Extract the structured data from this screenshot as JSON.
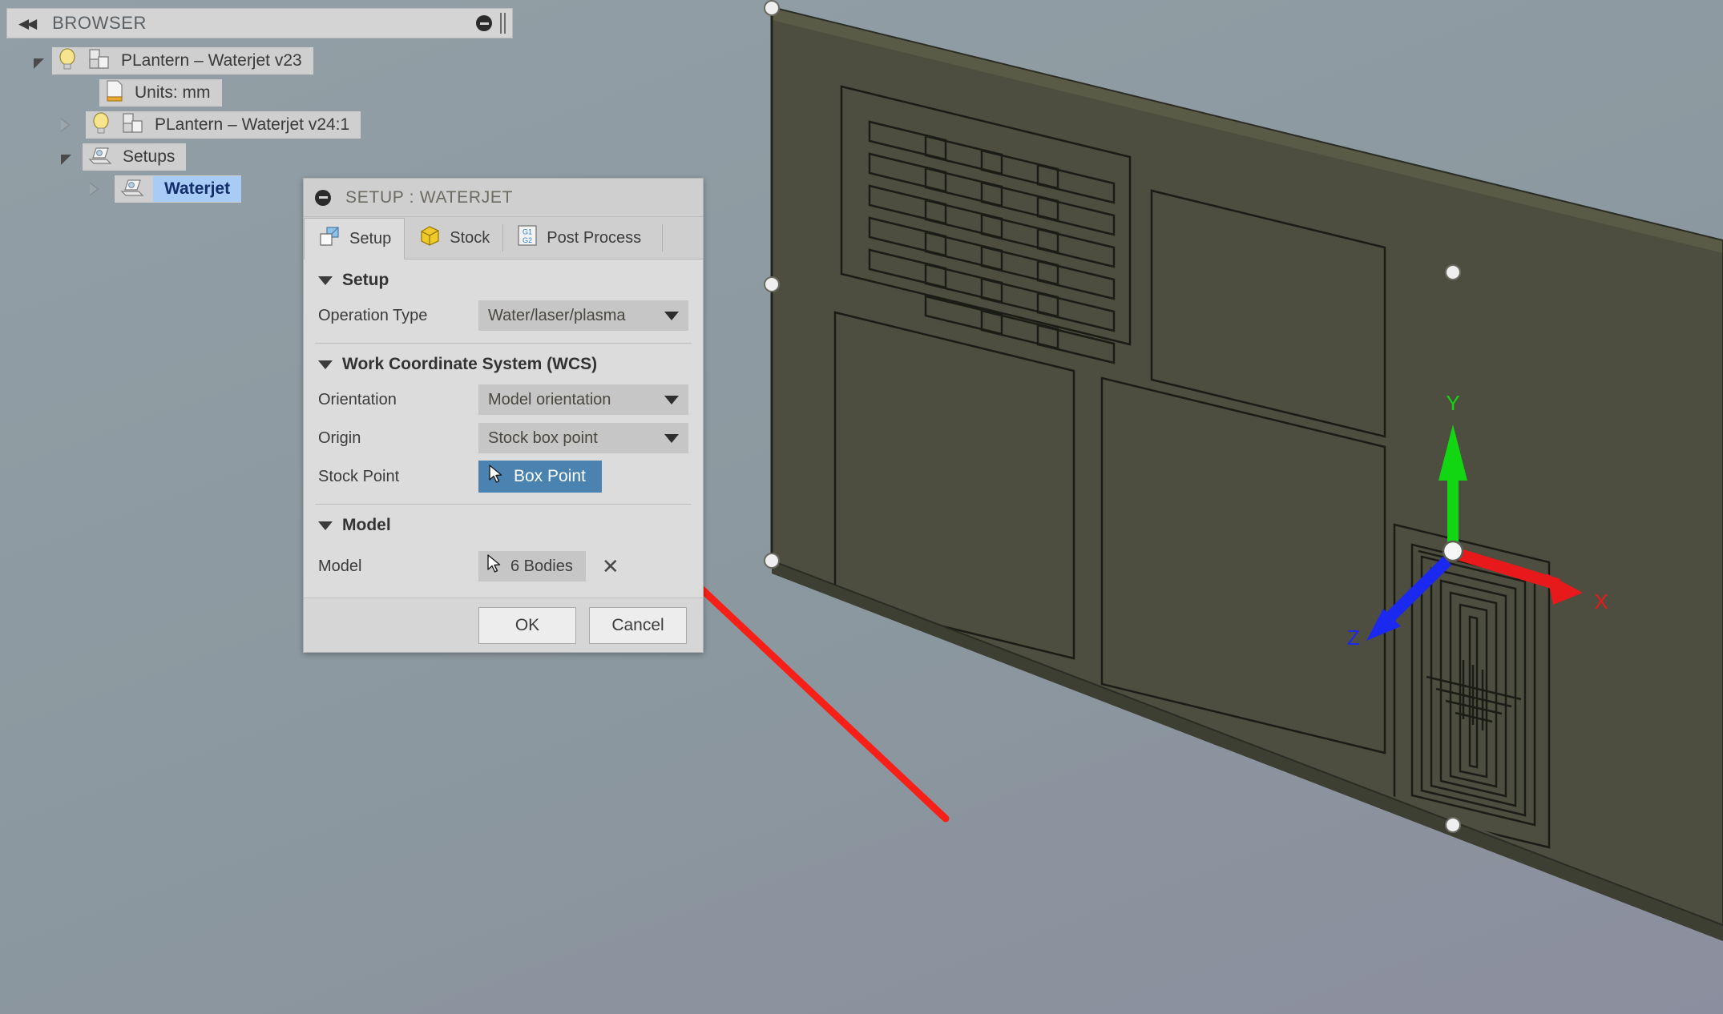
{
  "browser": {
    "title": "BROWSER",
    "collapse_icon": "double-left-arrows-icon",
    "minimize_icon": "minus-circle-icon",
    "grip_icon": "drag-grip-icon",
    "tree": [
      {
        "label": "PLantern – Waterjet v23",
        "icon": "component-icon",
        "bulb": "lightbulb-icon",
        "twisty": "expanded",
        "depth": 0,
        "selected": false
      },
      {
        "label": "Units: mm",
        "icon": "document-ruler-icon",
        "bulb": null,
        "twisty": "none",
        "depth": 1,
        "selected": false
      },
      {
        "label": "PLantern – Waterjet v24:1",
        "icon": "component-icon",
        "bulb": "lightbulb-icon",
        "twisty": "collapsed",
        "depth": 1,
        "selected": false
      },
      {
        "label": "Setups",
        "icon": "setup-folder-icon",
        "bulb": null,
        "twisty": "expanded",
        "depth": 1,
        "selected": false
      },
      {
        "label": "Waterjet",
        "icon": "setup-folder-icon",
        "bulb": null,
        "twisty": "collapsed",
        "depth": 2,
        "selected": true
      }
    ]
  },
  "dialog": {
    "title": "SETUP : WATERJET",
    "title_icon": "minus-circle-icon",
    "tabs": [
      {
        "label": "Setup",
        "icon": "setup-cube-icon",
        "active": true
      },
      {
        "label": "Stock",
        "icon": "stock-cube-icon",
        "active": false
      },
      {
        "label": "Post Process",
        "icon": "g1g2-icon",
        "active": false
      }
    ],
    "sections": [
      {
        "heading": "Setup",
        "rows": [
          {
            "name": "Operation Type",
            "type": "combo",
            "value": "Water/laser/plasma"
          }
        ]
      },
      {
        "heading": "Work Coordinate System (WCS)",
        "rows": [
          {
            "name": "Orientation",
            "type": "combo",
            "value": "Model orientation"
          },
          {
            "name": "Origin",
            "type": "combo",
            "value": "Stock box point"
          },
          {
            "name": "Stock Point",
            "type": "select-button-active",
            "value": "Box Point",
            "icon": "cursor-arrow-icon"
          }
        ]
      },
      {
        "heading": "Model",
        "rows": [
          {
            "name": "Model",
            "type": "select-field",
            "value": "6 Bodies",
            "icon": "cursor-arrow-icon",
            "clear_icon": "close-x-icon"
          }
        ]
      }
    ],
    "footer": {
      "ok_label": "OK",
      "cancel_label": "Cancel"
    }
  },
  "viewport": {
    "background_color": "#8d9aa0",
    "part_color": "#4b4c3f",
    "triad": {
      "x_label": "X",
      "x_color": "#e8191a",
      "y_label": "Y",
      "y_color": "#12d612",
      "z_label": "Z",
      "z_color": "#1b28ef",
      "origin_marker": "wcs-origin-sphere"
    },
    "annotation": {
      "type": "arrow",
      "color": "#f72018"
    }
  }
}
